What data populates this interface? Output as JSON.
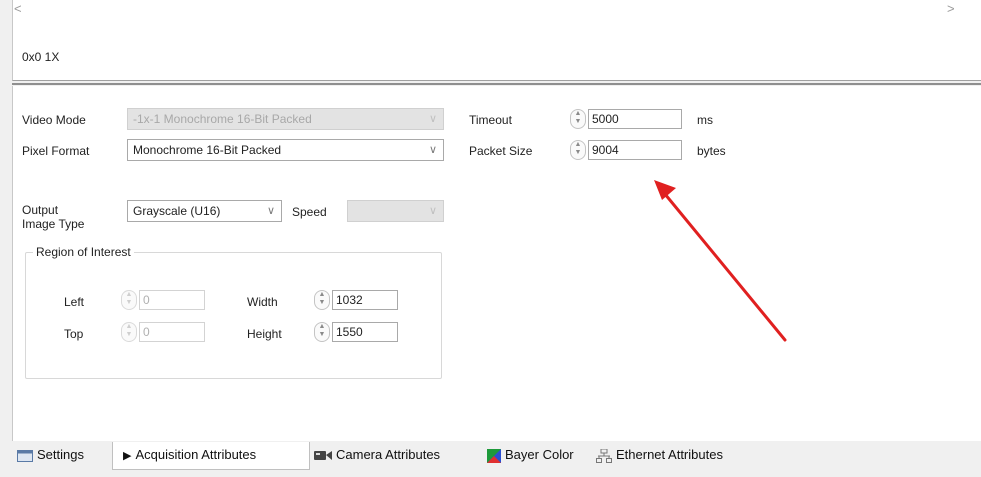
{
  "preview": {
    "left_arrow": "<",
    "right_arrow": ">",
    "zoom_label": "0x0 1X"
  },
  "form": {
    "video_mode": {
      "label": "Video Mode",
      "value": "-1x-1 Monochrome 16-Bit Packed",
      "enabled": false
    },
    "pixel_format": {
      "label": "Pixel Format",
      "value": "Monochrome 16-Bit Packed",
      "enabled": true
    },
    "output_image_type": {
      "label_line1": "Output",
      "label_line2": "Image Type",
      "value": "Grayscale (U16)"
    },
    "speed": {
      "label": "Speed",
      "value": "",
      "enabled": false
    },
    "timeout": {
      "label": "Timeout",
      "value": "5000",
      "unit": "ms"
    },
    "packet_size": {
      "label": "Packet Size",
      "value": "9004",
      "unit": "bytes"
    },
    "roi": {
      "title": "Region of Interest",
      "left": {
        "label": "Left",
        "value": "0",
        "enabled": false
      },
      "top": {
        "label": "Top",
        "value": "0",
        "enabled": false
      },
      "width": {
        "label": "Width",
        "value": "1032",
        "enabled": true
      },
      "height": {
        "label": "Height",
        "value": "1550",
        "enabled": true
      }
    }
  },
  "annotation": {
    "color": "#e02020"
  },
  "tabs": [
    {
      "label": "Settings",
      "icon": "settings-icon",
      "active": false
    },
    {
      "label": "Acquisition Attributes",
      "icon": "play-icon",
      "active": true
    },
    {
      "label": "Camera Attributes",
      "icon": "camera-icon",
      "active": false
    },
    {
      "label": "Bayer Color",
      "icon": "bayer-color-icon",
      "active": false
    },
    {
      "label": "Ethernet Attributes",
      "icon": "ethernet-icon",
      "active": false
    }
  ]
}
